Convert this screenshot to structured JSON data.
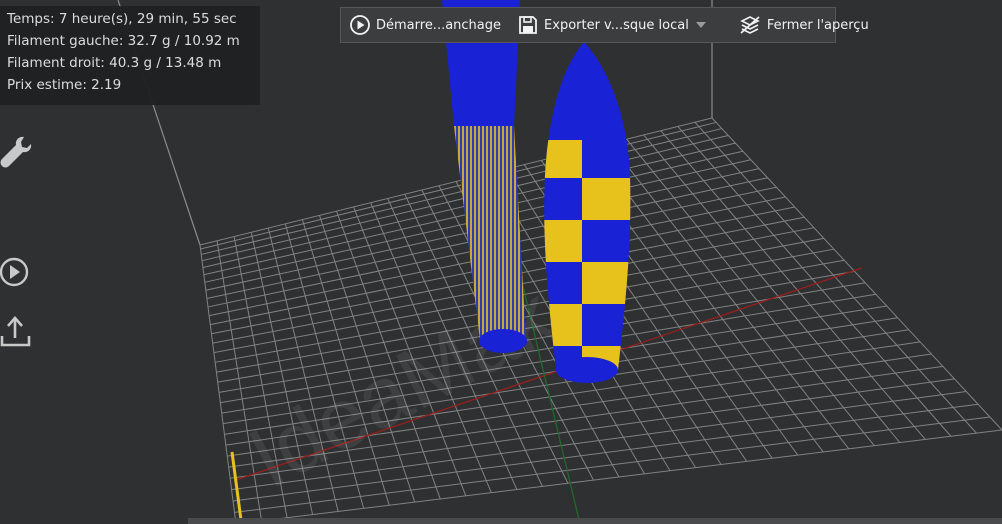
{
  "stats": {
    "time": "Temps: 7 heure(s), 29 min, 55 sec",
    "filament_left": "Filament gauche: 32.7 g / 10.92 m",
    "filament_right": "Filament droit: 40.3 g / 13.48 m",
    "price": "Prix estime: 2.19"
  },
  "toolbar": {
    "start_label": "Démarre...anchage",
    "export_label": "Exporter v...sque local",
    "close_preview_label": "Fermer l'aperçu"
  },
  "sidebar": {
    "icons": [
      "wrench-icon",
      "play-icon",
      "upload-icon"
    ]
  },
  "watermark": "IdeaMaker",
  "colors": {
    "background": "#2f3031",
    "grid": "#8a8b8c",
    "blue": "#1a22d6",
    "yellow": "#e7c21d",
    "x_axis": "#9a1e1e",
    "y_axis": "#1f6a2a"
  }
}
